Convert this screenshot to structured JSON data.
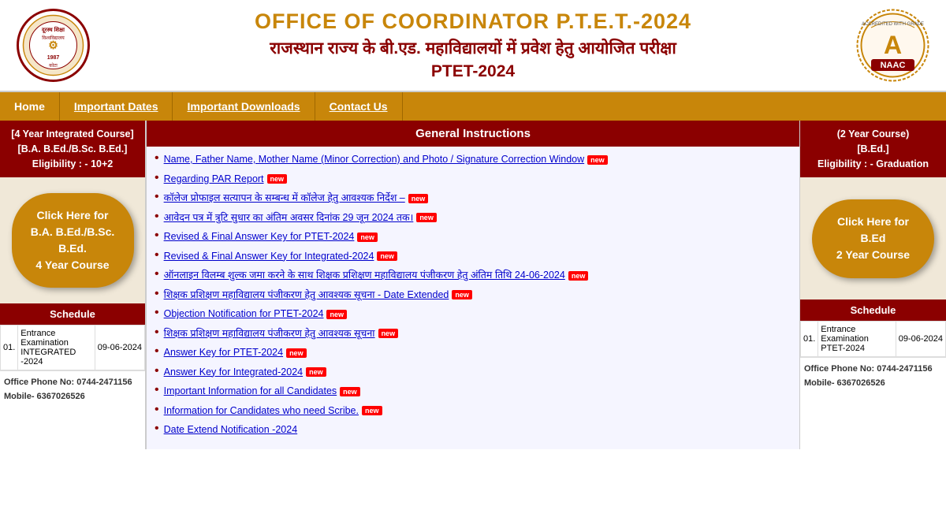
{
  "header": {
    "title_en": "OFFICE OF COORDINATOR P.T.E.T.-2024",
    "title_hi": "राजस्थान राज्य के बी.एड. महाविद्यालयों में प्रवेश हेतु आयोजित परीक्षा",
    "subtitle": "PTET-2024",
    "logo_alt": "University Logo",
    "naac_grade": "A",
    "naac_label": "NAAC",
    "naac_accredited": "ACCREDITED WITH GRADE"
  },
  "nav": {
    "items": [
      {
        "label": "Home",
        "underline": false
      },
      {
        "label": "Important Dates",
        "underline": true
      },
      {
        "label": "Important Downloads",
        "underline": true
      },
      {
        "label": "Contact Us",
        "underline": true
      }
    ]
  },
  "left_panel": {
    "header_line1": "[4 Year Integrated Course]",
    "header_line2": "[B.A. B.Ed./B.Sc. B.Ed.]",
    "header_line3": "Eligibility : - 10+2",
    "btn_label": "Click Here for\nB.A. B.Ed./B.Sc. B.Ed.\n4 Year Course",
    "schedule_title": "Schedule",
    "schedule_rows": [
      {
        "sno": "01.",
        "label": "Entrance Examination INTEGRATED -2024",
        "date": "09-06-2024"
      }
    ],
    "footer_line1": "Office Phone No: 0744-2471156",
    "footer_line2": "Mobile- 6367026526"
  },
  "center_panel": {
    "header": "General Instructions",
    "instructions": [
      {
        "text": "Name, Father Name, Mother Name (Minor Correction) and Photo / Signature Correction Window",
        "new": true
      },
      {
        "text": "Regarding PAR Report",
        "new": true
      },
      {
        "text": "कॉलेज प्रोफाइल सत्यापन के सम्बन्ध में कॉलेज हेतु आवश्यक निर्देश –",
        "new": true
      },
      {
        "text": "आवेदन पत्र में त्रुटि सुधार का अंतिम अवसर दिनांक 29 जून 2024 तक।",
        "new": true
      },
      {
        "text": "Revised & Final Answer Key for PTET-2024",
        "new": true
      },
      {
        "text": "Revised & Final Answer Key for Integrated-2024",
        "new": true
      },
      {
        "text": "ऑनलाइन विलम्ब शुल्क जमा करने के साथ शिक्षक प्रशिक्षण महाविद्यालय पंजीकरण हेतु अंतिम तिथि 24-06-2024",
        "new": true
      },
      {
        "text": "शिक्षक प्रशिक्षण महाविद्यालय पंजीकरण हेतु आवश्यक सूचना - Date Extended",
        "new": true
      },
      {
        "text": "Objection Notification for PTET-2024",
        "new": true
      },
      {
        "text": "शिक्षक प्रशिक्षण महाविद्यालय पंजीकरण हेतु आवश्यक सूचना",
        "new": true
      },
      {
        "text": "Answer Key for PTET-2024",
        "new": true
      },
      {
        "text": "Answer Key for Integrated-2024",
        "new": true
      },
      {
        "text": "Important Information for all Candidates",
        "new": true
      },
      {
        "text": "Information for Candidates who need Scribe.",
        "new": true
      },
      {
        "text": "Date Extend Notification -2024",
        "new": false
      }
    ]
  },
  "right_panel": {
    "header_line1": "(2 Year Course)",
    "header_line2": "[B.Ed.]",
    "header_line3": "Eligibility : - Graduation",
    "btn_label": "Click Here for\nB.Ed\n2 Year Course",
    "schedule_title": "Schedule",
    "schedule_rows": [
      {
        "sno": "01.",
        "label": "Entrance Examination PTET-2024",
        "date": "09-06-2024"
      }
    ],
    "footer_line1": "Office Phone No: 0744-2471156",
    "footer_line2": "Mobile- 6367026526"
  }
}
